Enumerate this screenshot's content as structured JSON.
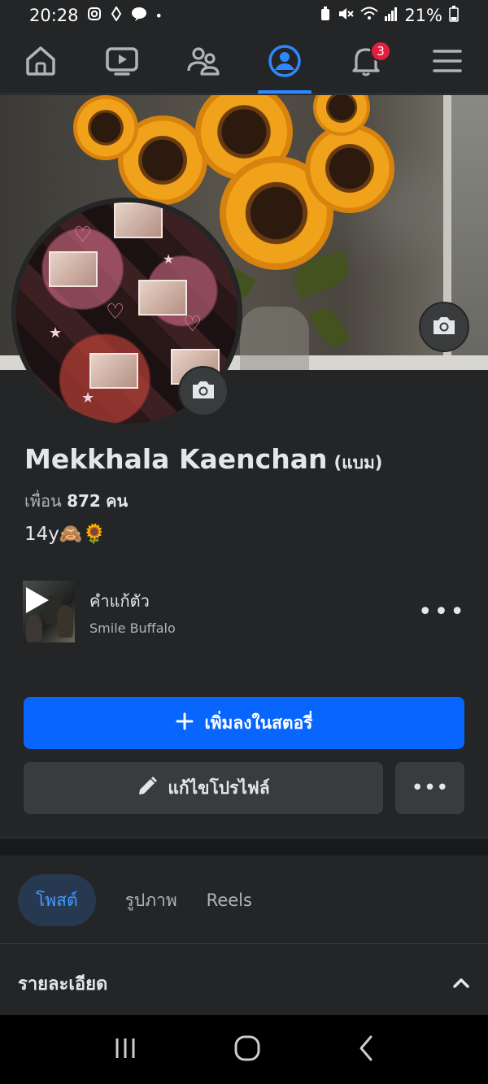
{
  "status_bar": {
    "time": "20:28",
    "battery": "21%",
    "app_icons": [
      "instagram-icon",
      "messenger-icon",
      "line-icon",
      "dot-icon"
    ],
    "system_icons": [
      "battery-saver-icon",
      "mute-icon",
      "wifi-icon",
      "signal-icon",
      "battery-icon"
    ]
  },
  "top_nav": {
    "items": [
      "home-icon",
      "video-icon",
      "friends-icon",
      "profile-icon",
      "bell-icon",
      "menu-icon"
    ],
    "active": "profile-icon",
    "notification_count": "3",
    "accent": "#2d88ff"
  },
  "profile": {
    "name": "Mekkhala Kaenchan",
    "nickname": "(แบม)",
    "friends_prefix": "เพื่อน",
    "friends_count": "872",
    "friends_suffix": "คน",
    "bio": "14y🙈🌻"
  },
  "music": {
    "song": "คำแก้ตัว",
    "artist": "Smile Buffalo",
    "more": "•••"
  },
  "buttons": {
    "add_story": "เพิ่มลงในสตอรี่",
    "edit_profile": "แก้ไขโปรไฟล์",
    "more": "•••",
    "primary_color": "#0866ff"
  },
  "tabs": [
    "โพสต์",
    "รูปภาพ",
    "Reels"
  ],
  "active_tab": "โพสต์",
  "details": {
    "title": "รายละเอียด"
  }
}
